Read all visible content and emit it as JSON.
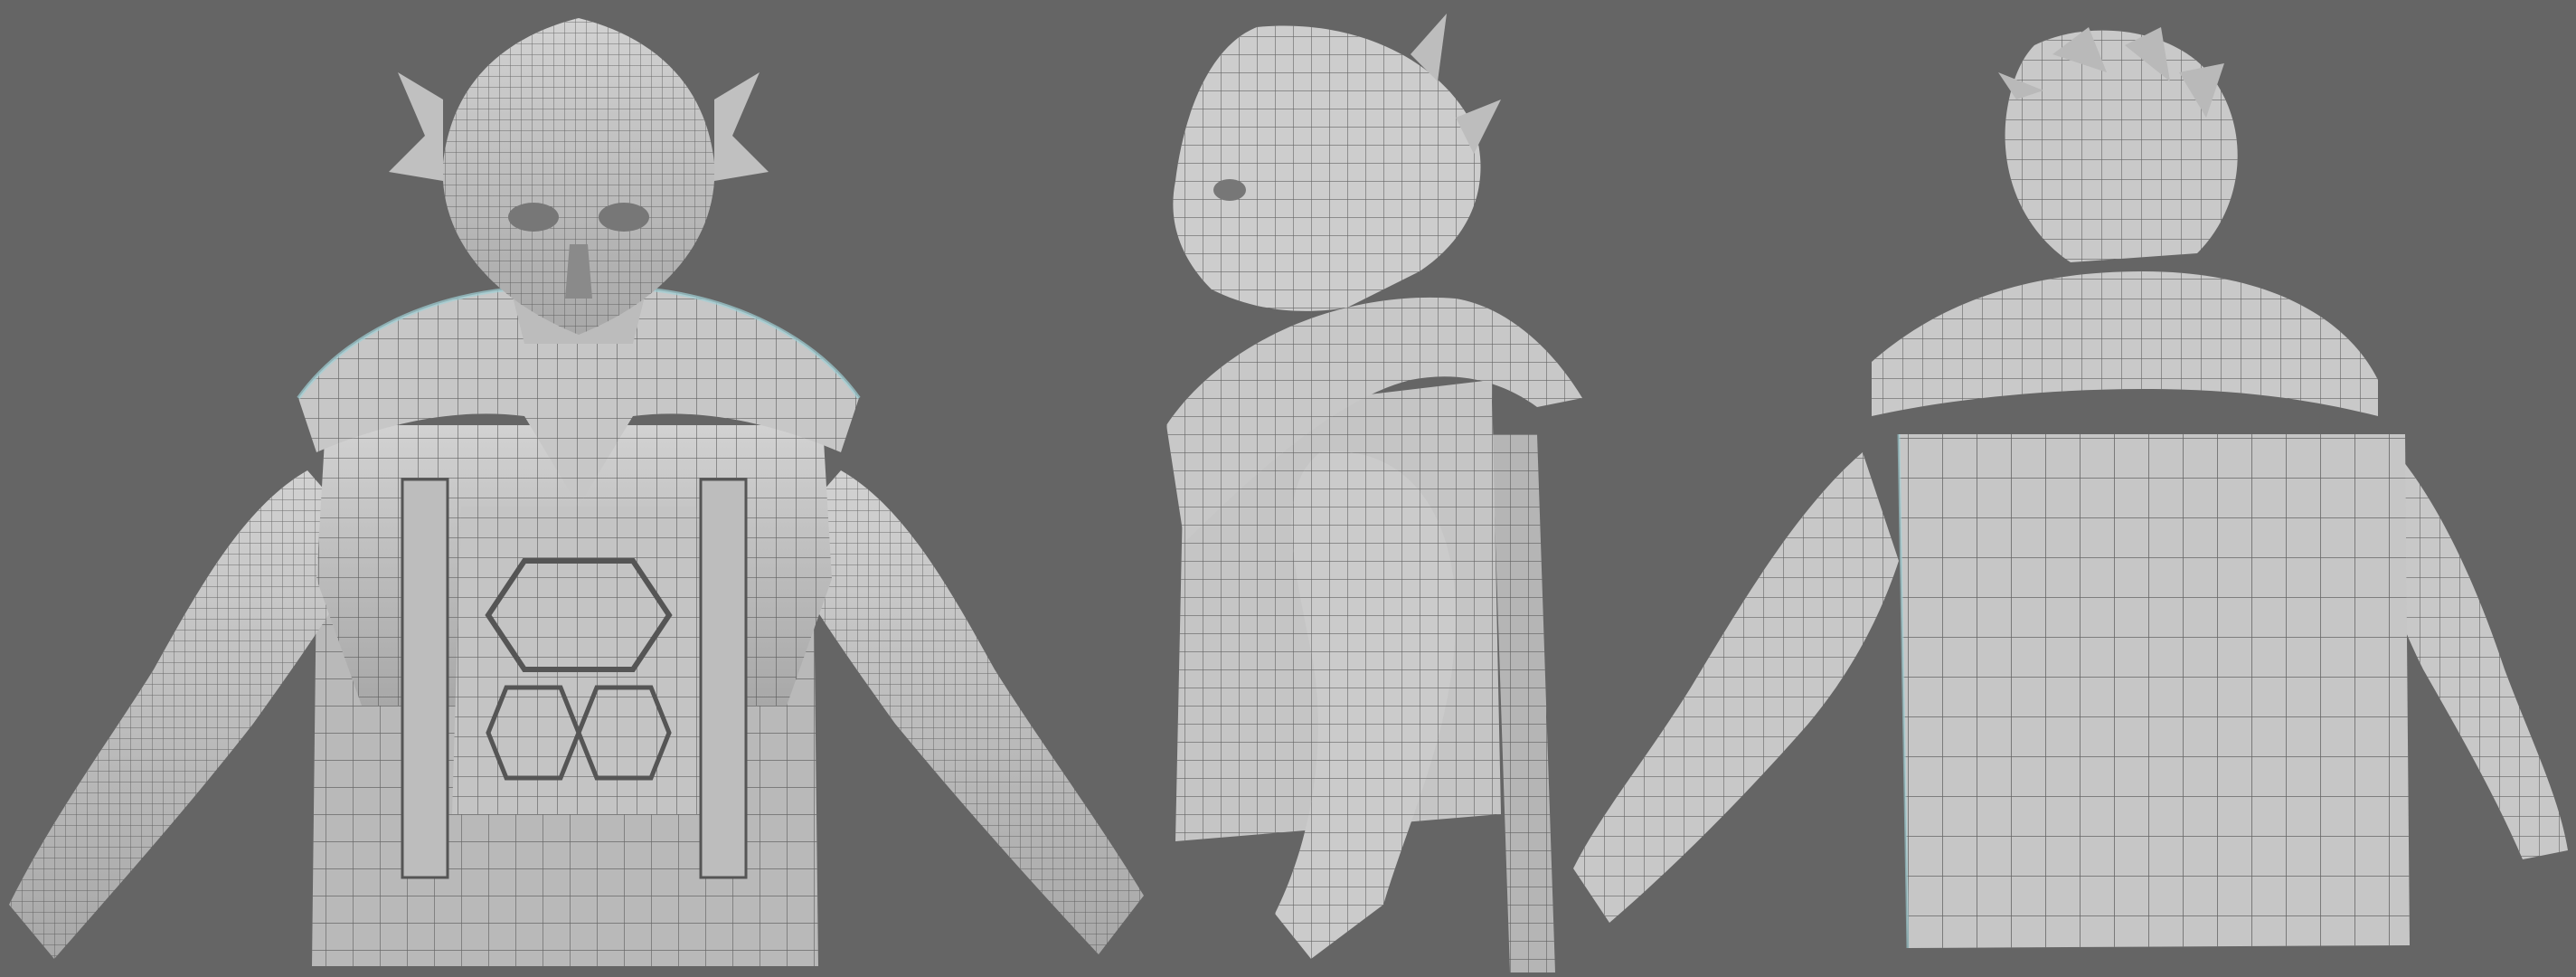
{
  "scene": {
    "background_color": "#656565",
    "mesh_color": "#c9c9c9",
    "mesh_shadow_color": "#8f8f8f",
    "wire_color": "#4a4a4a",
    "accent_color": "#9fd0d6",
    "views": [
      {
        "id": "front",
        "description_icon": "bust-front-view"
      },
      {
        "id": "side",
        "description_icon": "bust-side-view"
      },
      {
        "id": "back",
        "description_icon": "bust-back-view"
      }
    ]
  }
}
